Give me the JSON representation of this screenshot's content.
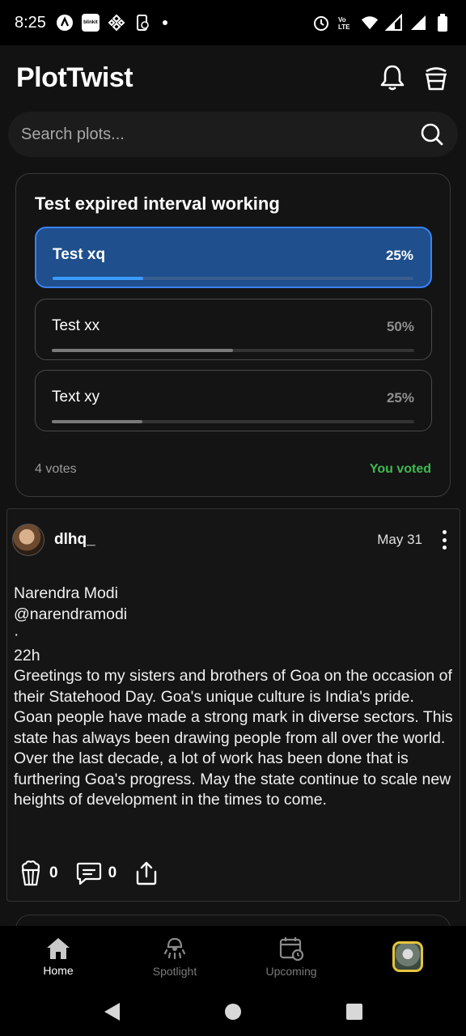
{
  "status_bar": {
    "time": "8:25",
    "badge_text": "blinkit"
  },
  "header": {
    "title": "PlotTwist"
  },
  "search": {
    "placeholder": "Search plots..."
  },
  "poll": {
    "question": "Test expired interval working",
    "options": [
      {
        "label": "Test xq",
        "percent_text": "25%",
        "fraction": 0.25,
        "selected": true
      },
      {
        "label": "Test xx",
        "percent_text": "50%",
        "fraction": 0.5,
        "selected": false
      },
      {
        "label": "Text xy",
        "percent_text": "25%",
        "fraction": 0.25,
        "selected": false
      }
    ],
    "votes_text": "4 votes",
    "voted_text": "You voted",
    "accent_color": "#3b82f6",
    "voted_color": "#3fb950"
  },
  "post": {
    "username": "dlhq_",
    "date": "May 31",
    "lines": [
      "Narendra Modi",
      "@narendramodi",
      "·",
      "22h",
      "Greetings to my sisters and brothers of Goa on the occasion of their Statehood Day. Goa's unique culture is India's pride. Goan people have made a strong mark in diverse sectors. This state has always been drawing people from all over the world. Over the last decade, a lot of work has been done that is furthering Goa's progress. May the state continue to scale new heights of development in the times to come."
    ],
    "like_count": "0",
    "comment_count": "0"
  },
  "nav": {
    "items": [
      {
        "label": "Home",
        "icon": "home-icon"
      },
      {
        "label": "Spotlight",
        "icon": "spotlight-icon"
      },
      {
        "label": "Upcoming",
        "icon": "calendar-icon"
      }
    ]
  }
}
